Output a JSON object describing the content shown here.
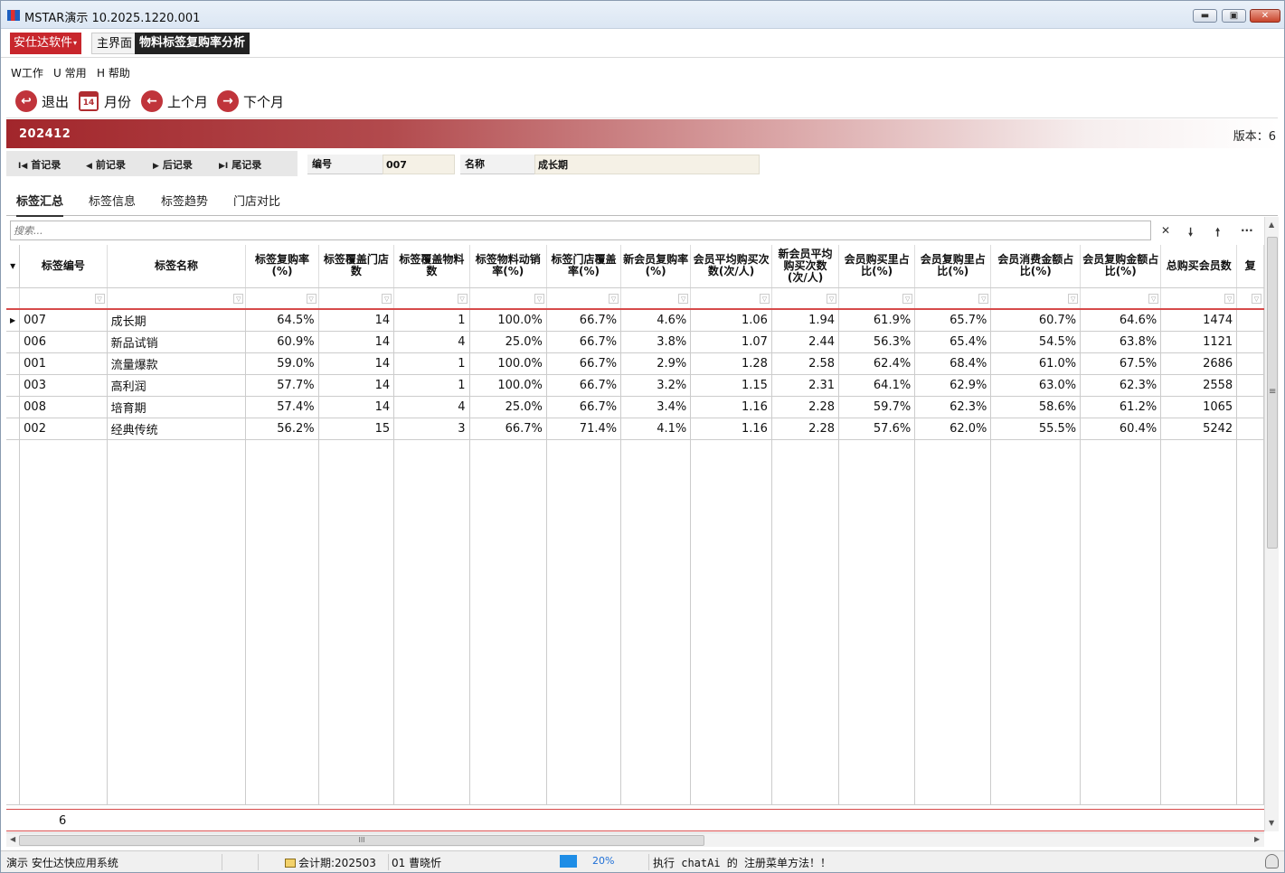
{
  "window": {
    "title": "MSTAR演示   10.2025.1220.001",
    "minimize_glyph": "▬",
    "maximize_glyph": "▣",
    "close_glyph": "✕"
  },
  "tabbar": {
    "brand": "安仕达软件",
    "brand_caret": "▾",
    "tabs": [
      {
        "label": "主界面",
        "active": false
      },
      {
        "label": "物料标签复购率分析",
        "active": true
      }
    ]
  },
  "menu": [
    "W工作",
    "U 常用",
    "H 帮助"
  ],
  "toolbar": {
    "exit": {
      "label": "退出",
      "icon": "exit-icon",
      "glyph": "↩"
    },
    "month": {
      "label": "月份",
      "icon": "calendar-icon",
      "glyph": "14"
    },
    "prev": {
      "label": "上个月",
      "icon": "arrow-left-icon",
      "glyph": "←"
    },
    "next": {
      "label": "下个月",
      "icon": "arrow-right-icon",
      "glyph": "→"
    }
  },
  "banner": {
    "period": "202412",
    "version": "版本：6",
    "accent": "#a2262b"
  },
  "record_nav": {
    "buttons": [
      {
        "label": "首记录",
        "glyph": "I◀"
      },
      {
        "label": "前记录",
        "glyph": "◀"
      },
      {
        "label": "后记录",
        "glyph": "▶"
      },
      {
        "label": "尾记录",
        "glyph": "▶I"
      }
    ],
    "code_label": "编号",
    "code_value": "007",
    "name_label": "名称",
    "name_value": "成长期"
  },
  "subtabs": [
    "标签汇总",
    "标签信息",
    "标签趋势",
    "门店对比"
  ],
  "search": {
    "placeholder": "搜索...",
    "icons": [
      {
        "name": "clear-search-icon",
        "glyph": "✕"
      },
      {
        "name": "search-next-icon",
        "glyph": "🠗"
      },
      {
        "name": "search-prev-icon",
        "glyph": "🠕"
      },
      {
        "name": "search-more-icon",
        "glyph": "···"
      }
    ]
  },
  "grid": {
    "header_arrow": "▾",
    "filter_glyph": "▽",
    "row_indicator": "▶",
    "columns": [
      {
        "label": "标签编号",
        "width": 98,
        "align": "left"
      },
      {
        "label": "标签名称",
        "width": 156,
        "align": "left"
      },
      {
        "label": "标签复购率(%)",
        "width": 81,
        "align": "right"
      },
      {
        "label": "标签覆盖门店数",
        "width": 85,
        "align": "right"
      },
      {
        "label": "标签覆盖物料数",
        "width": 85,
        "align": "right"
      },
      {
        "label": "标签物料动销率(%)",
        "width": 86,
        "align": "right"
      },
      {
        "label": "标签门店覆盖率(%)",
        "width": 83,
        "align": "right"
      },
      {
        "label": "新会员复购率(%)",
        "width": 78,
        "align": "right"
      },
      {
        "label": "会员平均购买次数(次/人)",
        "width": 91,
        "align": "right"
      },
      {
        "label": "新会员平均购买次数(次/人)",
        "width": 75,
        "align": "right"
      },
      {
        "label": "会员购买里占比(%)",
        "width": 85,
        "align": "right"
      },
      {
        "label": "会员复购里占比(%)",
        "width": 85,
        "align": "right"
      },
      {
        "label": "会员消费金额占比(%)",
        "width": 100,
        "align": "right"
      },
      {
        "label": "会员复购金额占比(%)",
        "width": 90,
        "align": "right"
      },
      {
        "label": "总购买会员数",
        "width": 85,
        "align": "right"
      },
      {
        "label": "复",
        "width": 30,
        "align": "right"
      }
    ],
    "rows": [
      [
        "007",
        "成长期",
        "64.5%",
        "14",
        "1",
        "100.0%",
        "66.7%",
        "4.6%",
        "1.06",
        "1.94",
        "61.9%",
        "65.7%",
        "60.7%",
        "64.6%",
        "1474",
        ""
      ],
      [
        "006",
        "新品试销",
        "60.9%",
        "14",
        "4",
        "25.0%",
        "66.7%",
        "3.8%",
        "1.07",
        "2.44",
        "56.3%",
        "65.4%",
        "54.5%",
        "63.8%",
        "1121",
        ""
      ],
      [
        "001",
        "流量爆款",
        "59.0%",
        "14",
        "1",
        "100.0%",
        "66.7%",
        "2.9%",
        "1.28",
        "2.58",
        "62.4%",
        "68.4%",
        "61.0%",
        "67.5%",
        "2686",
        ""
      ],
      [
        "003",
        "高利润",
        "57.7%",
        "14",
        "1",
        "100.0%",
        "66.7%",
        "3.2%",
        "1.15",
        "2.31",
        "64.1%",
        "62.9%",
        "63.0%",
        "62.3%",
        "2558",
        ""
      ],
      [
        "008",
        "培育期",
        "57.4%",
        "14",
        "4",
        "25.0%",
        "66.7%",
        "3.4%",
        "1.16",
        "2.28",
        "59.7%",
        "62.3%",
        "58.6%",
        "61.2%",
        "1065",
        ""
      ],
      [
        "002",
        "经典传统",
        "56.2%",
        "15",
        "3",
        "66.7%",
        "71.4%",
        "4.1%",
        "1.16",
        "2.28",
        "57.6%",
        "62.0%",
        "55.5%",
        "60.4%",
        "5242",
        ""
      ]
    ],
    "footer_count": "6"
  },
  "scroll": {
    "up": "▲",
    "down": "▼",
    "left": "◀",
    "right": "▶",
    "grip_v": "≡",
    "grip_h": "III"
  },
  "statusbar": {
    "app": "演示 安仕达快应用系统",
    "period": "会计期:202503",
    "user": "01 曹晓忻",
    "progress": "20%",
    "message": "执行 chatAi 的 注册菜单方法！！"
  }
}
